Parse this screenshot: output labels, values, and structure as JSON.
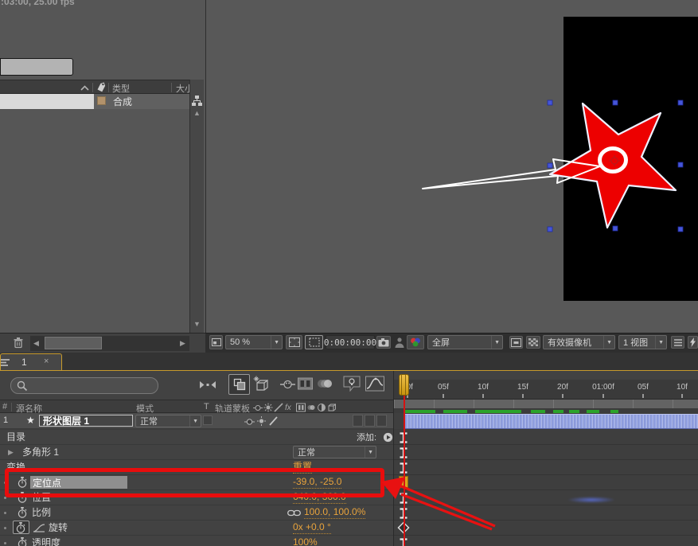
{
  "project": {
    "info_text": ":03:00, 25.00 fps",
    "columns": {
      "type": "类型",
      "size": "大小"
    },
    "item": {
      "type_label": "合成"
    }
  },
  "viewer": {
    "zoom_level": "50 %",
    "timecode": "0:00:00:00",
    "resolution": "全屏",
    "camera": "有效摄像机",
    "views": "1 视图"
  },
  "timeline": {
    "tab_label": "1",
    "tab_close": "×",
    "ruler": [
      "00f",
      "05f",
      "10f",
      "15f",
      "20f",
      "01:00f",
      "05f",
      "10f"
    ],
    "header": {
      "index": "#",
      "source": "源名称",
      "mode": "模式",
      "t": "T",
      "matte": "轨道蒙板",
      "fx": "fx"
    },
    "layer": {
      "index": "1",
      "name": "形状图层 1",
      "mode": "正常"
    }
  },
  "props": {
    "contents": {
      "label": "目录",
      "add": "添加:"
    },
    "polystar": {
      "label": "多角形 1",
      "mode": "正常"
    },
    "transform": {
      "label": "变换",
      "reset": "重置"
    },
    "anchor": {
      "label": "定位点",
      "value": "-39.0, -25.0"
    },
    "position": {
      "label": "位置",
      "value": "640.0, 360.0"
    },
    "scale": {
      "label": "比例",
      "value": "100.0, 100.0%"
    },
    "rotation": {
      "label": "旋转",
      "value": "0x +0.0 °"
    },
    "opacity": {
      "label": "透明度",
      "value": "100%"
    }
  },
  "colors": {
    "value_orange": "#e8a33c",
    "annotation_red": "#e80d0d",
    "cti_red": "#d51212",
    "layer_bar_blue": "#93a2e2",
    "cache_green": "#2ba32b",
    "handle_blue": "#4656d8",
    "tab_gold": "#c79a2c",
    "star_red": "#ed0000"
  }
}
